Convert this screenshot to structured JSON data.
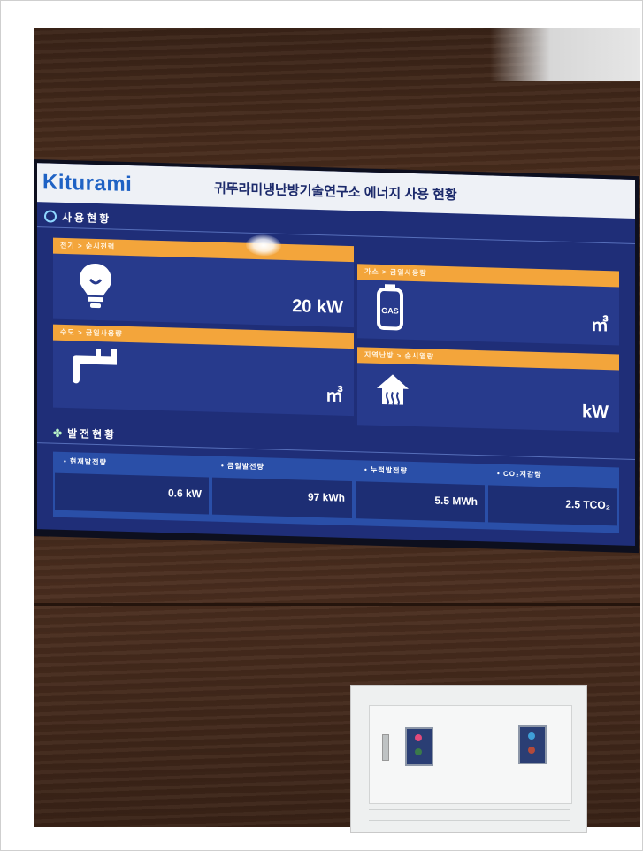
{
  "screen": {
    "logo": "Kiturami",
    "title": "귀뚜라미냉난방기술연구소 에너지 사용 현황",
    "usage_section": "사용현황",
    "generation_section": "발전현황",
    "tiles": [
      {
        "label": "전기 > 순시전력",
        "value": "20 kW"
      },
      {
        "label": "가스 > 금일사용량",
        "value": "㎥"
      },
      {
        "label": "수도 > 금일사용량",
        "value": "㎥"
      },
      {
        "label": "지역난방 > 순시열량",
        "value": "kW"
      }
    ],
    "generation": [
      {
        "label": "현재발전량",
        "value": "0.6 kW"
      },
      {
        "label": "금일발전량",
        "value": "97 kWh"
      },
      {
        "label": "누적발전량",
        "value": "5.5 MWh"
      },
      {
        "label": "CO₂저감량",
        "value": "2.5 TCO₂"
      }
    ]
  },
  "colors": {
    "screen_bg": "#1f2e78",
    "tile_header": "#f3a53b",
    "logo_blue": "#1f62c4",
    "wood": "#4a2d1d"
  },
  "icons": [
    "light-bulb-icon",
    "gas-tank-icon",
    "faucet-icon",
    "house-heat-icon",
    "clover-icon"
  ]
}
